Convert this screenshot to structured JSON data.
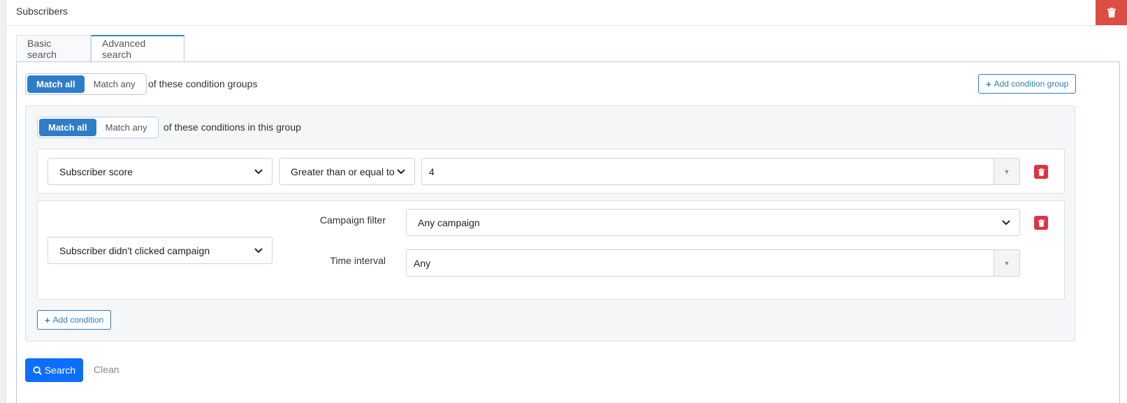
{
  "header": {
    "title": "Subscribers",
    "delete_icon": "trash-icon",
    "delete_color": "#dc4d43"
  },
  "tabs": [
    {
      "label": "Basic search",
      "active": false
    },
    {
      "label": "Advanced search",
      "active": true
    }
  ],
  "groups_match": {
    "options": [
      "Match all",
      "Match any"
    ],
    "selected": "Match all",
    "suffix": "of these condition groups",
    "add_group_label": "Add condition group"
  },
  "group": {
    "match": {
      "options": [
        "Match all",
        "Match any"
      ],
      "selected": "Match all",
      "suffix": "of these conditions in this group"
    },
    "conditions": [
      {
        "field": "Subscriber score",
        "operator": "Greater than or equal to",
        "value": "4"
      },
      {
        "field": "Subscriber didn't clicked campaign",
        "campaign_filter_label": "Campaign filter",
        "campaign_filter_value": "Any campaign",
        "time_interval_label": "Time interval",
        "time_interval_value": "Any"
      }
    ],
    "add_condition_label": "Add condition"
  },
  "actions": {
    "search_label": "Search",
    "clean_label": "Clean"
  },
  "colors": {
    "primary": "#0d6efd",
    "accent": "#2f7dc8",
    "danger": "#dc3545"
  }
}
